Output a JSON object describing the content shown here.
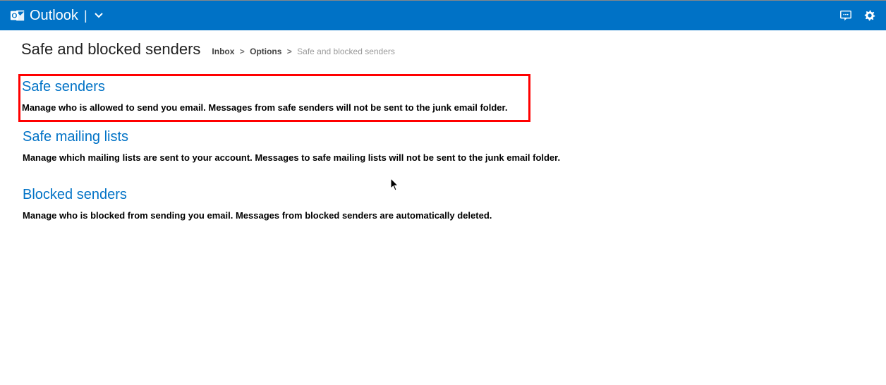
{
  "header": {
    "brand": "Outlook"
  },
  "page": {
    "title": "Safe and blocked senders"
  },
  "breadcrumb": {
    "items": [
      "Inbox",
      "Options",
      "Safe and blocked senders"
    ]
  },
  "sections": [
    {
      "title": "Safe senders",
      "desc": "Manage who is allowed to send you email. Messages from safe senders will not be sent to the junk email folder.",
      "highlighted": true
    },
    {
      "title": "Safe mailing lists",
      "desc": "Manage which mailing lists are sent to your account. Messages to safe mailing lists will not be sent to the junk email folder.",
      "highlighted": false
    },
    {
      "title": "Blocked senders",
      "desc": "Manage who is blocked from sending you email. Messages from blocked senders are automatically deleted.",
      "highlighted": false
    }
  ],
  "colors": {
    "accent": "#0072C6",
    "highlight_border": "#ff0000"
  }
}
